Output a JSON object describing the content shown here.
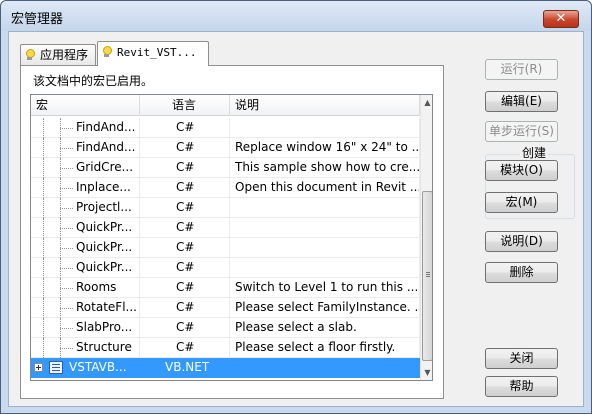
{
  "window": {
    "title": "宏管理器",
    "close_glyph": "✕"
  },
  "tabs": [
    {
      "label": "应用程序"
    },
    {
      "label": "Revit_VST..."
    }
  ],
  "panel": {
    "description": "该文档中的宏已启用。"
  },
  "table": {
    "columns": [
      "宏",
      "语言",
      "说明"
    ],
    "rows": [
      {
        "name": "FindAnd...",
        "lang": "C#",
        "desc": ""
      },
      {
        "name": "FindAnd...",
        "lang": "C#",
        "desc": "Replace window 16\" x 24\" to ..."
      },
      {
        "name": "GridCre...",
        "lang": "C#",
        "desc": "This sample show how to cre..."
      },
      {
        "name": "Inplace...",
        "lang": "C#",
        "desc": "Open this document in Revit ..."
      },
      {
        "name": "Projectl...",
        "lang": "C#",
        "desc": ""
      },
      {
        "name": "QuickPr...",
        "lang": "C#",
        "desc": ""
      },
      {
        "name": "QuickPr...",
        "lang": "C#",
        "desc": ""
      },
      {
        "name": "QuickPr...",
        "lang": "C#",
        "desc": ""
      },
      {
        "name": "Rooms",
        "lang": "C#",
        "desc": "Switch to Level 1 to run this ..."
      },
      {
        "name": "RotateFl...",
        "lang": "C#",
        "desc": "Please select FamilyInstance. ..."
      },
      {
        "name": "SlabPro...",
        "lang": "C#",
        "desc": "Please select a slab."
      },
      {
        "name": "Structure",
        "lang": "C#",
        "desc": "Please select a floor firstly."
      }
    ],
    "selected_row": {
      "name": "VSTAVB...",
      "lang": "VB.NET",
      "desc": ""
    }
  },
  "buttons": {
    "run": "运行(R)",
    "edit": "编辑(E)",
    "step": "单步运行(S)",
    "create_group": "创建",
    "module": "模块(O)",
    "macro": "宏(M)",
    "explain": "说明(D)",
    "delete": "删除",
    "close": "关闭",
    "help": "帮助"
  },
  "colors": {
    "selection": "#3399ff",
    "title_bg": "#c9d9ee"
  },
  "icons": [
    "lightbulb-icon",
    "expand-icon",
    "project-icon",
    "scroll-up-icon",
    "scroll-down-icon"
  ]
}
